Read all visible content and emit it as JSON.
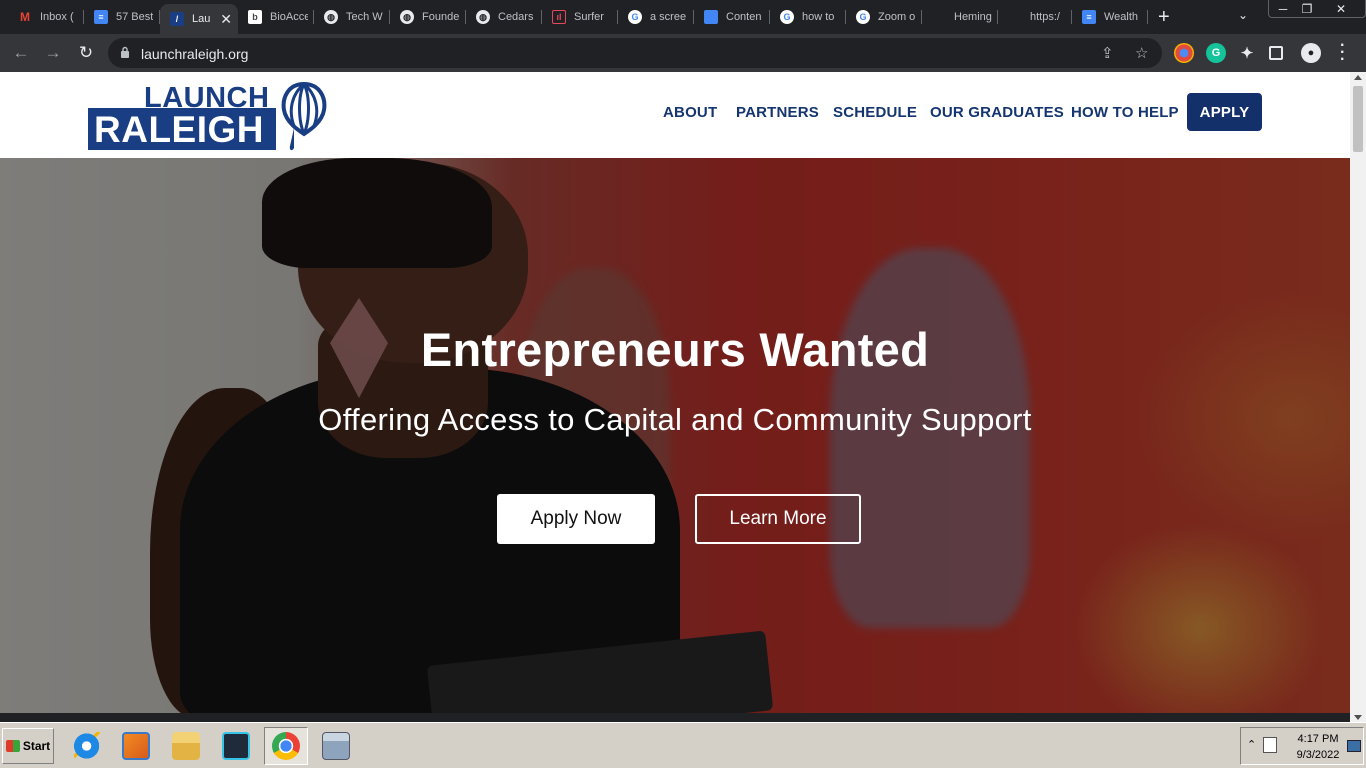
{
  "browser": {
    "tabs": [
      {
        "label": "Inbox (",
        "icon": "gmail-icon",
        "color": "#ea4335",
        "active": false
      },
      {
        "label": "57 Best",
        "icon": "google-docs-icon",
        "color": "#4285f4",
        "active": false
      },
      {
        "label": "Lau",
        "icon": "launch-raleigh-icon",
        "color": "#1a3e84",
        "active": true
      },
      {
        "label": "BioAcce",
        "icon": "bioaccess-icon",
        "color": "#ffffff",
        "active": false
      },
      {
        "label": "Tech W",
        "icon": "globe-icon",
        "color": "#e8eaed",
        "active": false
      },
      {
        "label": "Founde",
        "icon": "globe-icon",
        "color": "#e8eaed",
        "active": false
      },
      {
        "label": "Cedars",
        "icon": "globe-icon",
        "color": "#e8eaed",
        "active": false
      },
      {
        "label": "Surfer",
        "icon": "surfer-icon",
        "color": "#e5475b",
        "active": false
      },
      {
        "label": "a scree",
        "icon": "google-icon",
        "color": "#ffffff",
        "active": false
      },
      {
        "label": "Conten",
        "icon": "docs-blue-icon",
        "color": "#4285f4",
        "active": false
      },
      {
        "label": "how to",
        "icon": "google-icon",
        "color": "#ffffff",
        "active": false
      },
      {
        "label": "Zoom o",
        "icon": "google-icon",
        "color": "#ffffff",
        "active": false
      },
      {
        "label": "Heming",
        "icon": "blank-icon",
        "color": "#202124",
        "active": false
      },
      {
        "label": "https:/",
        "icon": "blank-icon",
        "color": "#202124",
        "active": false
      },
      {
        "label": "Wealth",
        "icon": "google-docs-icon",
        "color": "#4285f4",
        "active": false
      }
    ],
    "url": "launchraleigh.org"
  },
  "site": {
    "logo": {
      "top": "LAUNCH",
      "bottom": "RALEIGH"
    },
    "nav": [
      "ABOUT",
      "PARTNERS",
      "SCHEDULE",
      "OUR GRADUATES",
      "HOW TO HELP"
    ],
    "apply_label": "APPLY",
    "colors": {
      "brand": "#13306b",
      "accent": "#ffffff"
    }
  },
  "hero": {
    "title": "Entrepreneurs Wanted",
    "subtitle": "Offering Access to Capital and Community Support",
    "primary_button": "Apply Now",
    "secondary_button": "Learn More"
  },
  "taskbar": {
    "start_label": "Start",
    "apps": [
      "internet-explorer-icon",
      "media-player-icon",
      "file-explorer-icon",
      "vpn-shield-icon",
      "chrome-icon",
      "calculator-icon"
    ],
    "time": "4:17 PM",
    "date": "9/3/2022"
  }
}
